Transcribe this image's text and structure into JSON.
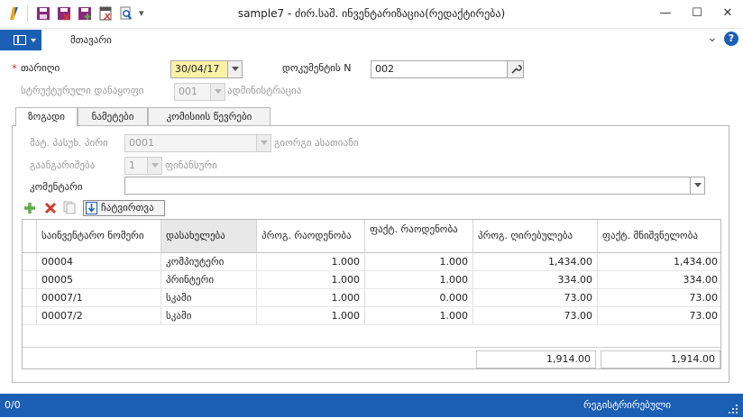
{
  "window": {
    "title": "sample7 - ძირ.საშ. ინვენტარიზაცია(რედაქტირება)",
    "minimize": "—",
    "maximize": "☐",
    "close": "✕"
  },
  "quick_access": {
    "icons": [
      "app-logo-icon",
      "save-icon",
      "save-close-icon",
      "save-new-icon",
      "print-preview-icon",
      "search-icon",
      "customize-icon"
    ],
    "customize_glyph": "▾"
  },
  "menu": {
    "home_tab": "მთავარი",
    "help_glyph": "?",
    "collapse_glyph": "⌄"
  },
  "header_form": {
    "date_label": "თარიღი",
    "date_required_mark": "*",
    "date_value": "30/04/17",
    "doc_number_label": "დოკუმენტის N",
    "doc_number_value": "002",
    "struct_unit_label": "სტრუქტურული დანაყოფი",
    "struct_unit_code": "001",
    "struct_unit_name": "ადმინისტრაცია"
  },
  "tabs": [
    {
      "label": "ზოგადი",
      "active": true
    },
    {
      "label": "ნამეტები",
      "active": false
    },
    {
      "label": "კომისიის წევრები",
      "active": false
    }
  ],
  "general_tab": {
    "responsible_label": "მატ. პასუხ. პირი",
    "responsible_code": "0001",
    "responsible_name": "გიორგი ასათიანი",
    "account_label": "გაანგარიშება",
    "account_code": "1",
    "account_name": "ფინანსური",
    "comment_label": "კომენტარი",
    "comment_value": ""
  },
  "toolbar": {
    "load_label": "ჩატვირთვა"
  },
  "grid": {
    "columns": [
      "საინვენტარო ნომერი",
      "დასახელება",
      "პროგ. რაოდენობა",
      "ფაქტ. რაოდენობა",
      "პროგ. ღირებულება",
      "ფაქტ. მნიშვნელობა"
    ],
    "rows": [
      [
        "00004",
        "კომპიუტერი",
        "1.000",
        "1.000",
        "1,434.00",
        "1,434.00"
      ],
      [
        "00005",
        "პრინტერი",
        "1.000",
        "1.000",
        "334.00",
        "334.00"
      ],
      [
        "00007/1",
        "სკამი",
        "1.000",
        "0.000",
        "73.00",
        "73.00"
      ],
      [
        "00007/2",
        "სკამი",
        "1.000",
        "1.000",
        "73.00",
        "73.00"
      ]
    ],
    "totals": {
      "prog_value": "1,914.00",
      "fact_value": "1,914.00"
    }
  },
  "status": {
    "left": "0/0",
    "right": "რეგისტრირებული"
  },
  "colors": {
    "accent": "#1a5fb4",
    "required": "#d9342b",
    "date_highlight": "#fbf2a6",
    "add_green": "#5cae46",
    "delete_red": "#d33a2c"
  }
}
